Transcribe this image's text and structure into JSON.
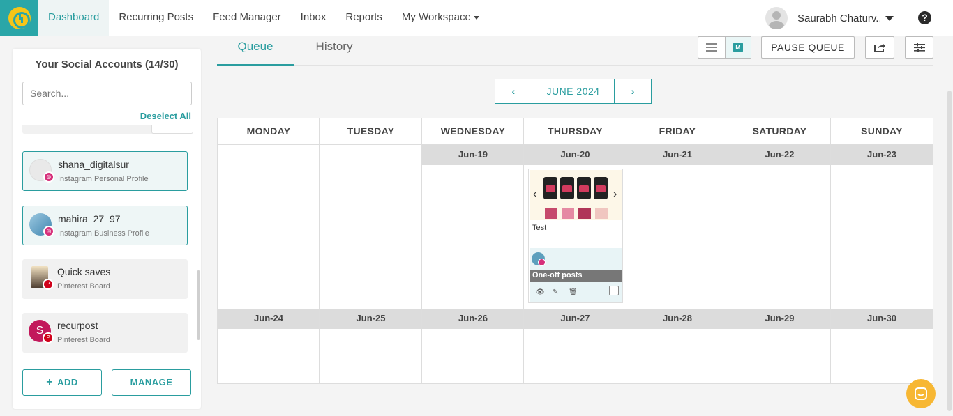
{
  "nav": {
    "items": [
      "Dashboard",
      "Recurring Posts",
      "Feed Manager",
      "Inbox",
      "Reports",
      "My Workspace"
    ],
    "user_name": "Saurabh Chaturv..."
  },
  "sidebar": {
    "title": "Your Social Accounts (14/30)",
    "search_placeholder": "Search...",
    "deselect_all": "Deselect All",
    "accounts": [
      {
        "name": "shana_digitalsur",
        "type": "Instagram Personal Profile",
        "selected": true,
        "network": "instagram-icon"
      },
      {
        "name": "mahira_27_97",
        "type": "Instagram Business Profile",
        "selected": true,
        "network": "instagram-icon"
      },
      {
        "name": "Quick saves",
        "type": "Pinterest Board",
        "selected": false,
        "network": "pinterest-icon"
      },
      {
        "name": "recurpost",
        "type": "Pinterest Board",
        "selected": false,
        "network": "pinterest-icon",
        "initial": "S"
      }
    ],
    "add_label": "ADD",
    "manage_label": "MANAGE"
  },
  "main": {
    "tabs": [
      "Queue",
      "History"
    ],
    "pause_label": "PAUSE QUEUE",
    "month_label": "JUNE 2024",
    "accent": "#2a9d9f"
  },
  "calendar": {
    "days": [
      "MONDAY",
      "TUESDAY",
      "WEDNESDAY",
      "THURSDAY",
      "FRIDAY",
      "SATURDAY",
      "SUNDAY"
    ],
    "week1_dates": [
      "",
      "",
      "Jun-19",
      "Jun-20",
      "Jun-21",
      "Jun-22",
      "Jun-23"
    ],
    "week2_dates": [
      "Jun-24",
      "Jun-25",
      "Jun-26",
      "Jun-27",
      "Jun-28",
      "Jun-29",
      "Jun-30"
    ],
    "post": {
      "text": "Test",
      "category": "One-off posts"
    }
  }
}
